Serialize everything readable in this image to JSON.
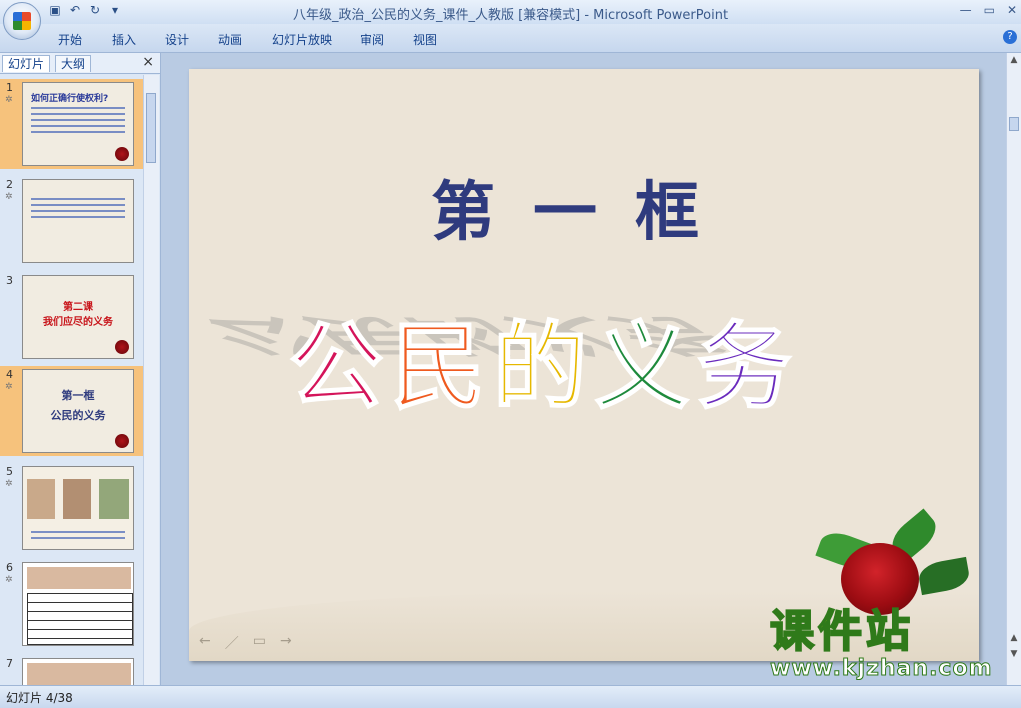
{
  "window": {
    "title": "八年级_政治_公民的义务_课件_人教版 [兼容模式] - Microsoft PowerPoint",
    "controls": [
      "—",
      "▭",
      "✕"
    ]
  },
  "quick_access": [
    "save-icon",
    "undo-icon",
    "redo-icon",
    "customize-icon"
  ],
  "ribbon": {
    "tabs": [
      "开始",
      "插入",
      "设计",
      "动画",
      "幻灯片放映",
      "审阅",
      "视图"
    ],
    "help_label": "?"
  },
  "panel": {
    "tabs": [
      "幻灯片",
      "大纲"
    ],
    "close_label": "×",
    "thumbnails": [
      {
        "number": "1",
        "title": "如何正确行使权利?",
        "selected": false
      },
      {
        "number": "2",
        "title": "",
        "selected": false
      },
      {
        "number": "3",
        "title": "第二课\n我们应尽的义务",
        "selected": false
      },
      {
        "number": "4",
        "title": "第一框\n公民的义务",
        "selected": true
      },
      {
        "number": "5",
        "title": "",
        "selected": false
      },
      {
        "number": "6",
        "title": "",
        "selected": false
      },
      {
        "number": "7",
        "title": "",
        "selected": false
      }
    ]
  },
  "slide": {
    "subtitle": "第一框",
    "title_chars": [
      "公",
      "民",
      "的",
      "义",
      "务"
    ],
    "title_colors": [
      "#d4145a",
      "#ef5a1f",
      "#e6b800",
      "#1e8a3c",
      "#6a2bbd"
    ],
    "nav_icons": [
      "←",
      "／",
      "▭",
      "→"
    ]
  },
  "watermark": {
    "cn": "课件站",
    "url": "www.kjzhan.com"
  },
  "status": {
    "slide_counter": "幻灯片 4/38"
  }
}
